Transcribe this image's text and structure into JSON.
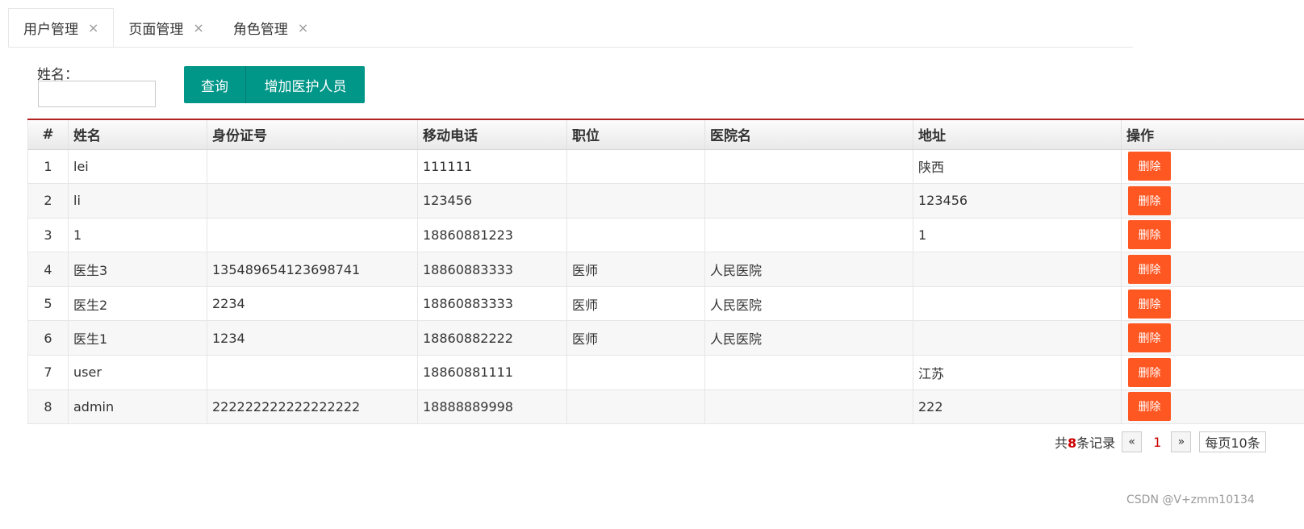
{
  "tabs": [
    {
      "label": "用户管理",
      "close": "×"
    },
    {
      "label": "页面管理",
      "close": "×"
    },
    {
      "label": "角色管理",
      "close": "×"
    }
  ],
  "search": {
    "label": "姓名：",
    "value": "",
    "placeholder": ""
  },
  "buttons": {
    "query": "查询",
    "add": "增加医护人员"
  },
  "table": {
    "headers": [
      "#",
      "姓名",
      "身份证号",
      "移动电话",
      "职位",
      "医院名",
      "地址",
      "操作"
    ],
    "delete_label": "删除",
    "rows": [
      [
        "1",
        "lei",
        "",
        "111111",
        "",
        "",
        "陕西"
      ],
      [
        "2",
        "li",
        "",
        "123456",
        "",
        "",
        "123456"
      ],
      [
        "3",
        "1",
        "",
        "18860881223",
        "",
        "",
        "1"
      ],
      [
        "4",
        "医生3",
        "135489654123698741",
        "18860883333",
        "医师",
        "人民医院",
        ""
      ],
      [
        "5",
        "医生2",
        "2234",
        "18860883333",
        "医师",
        "人民医院",
        ""
      ],
      [
        "6",
        "医生1",
        "1234",
        "18860882222",
        "医师",
        "人民医院",
        ""
      ],
      [
        "7",
        "user",
        "",
        "18860881111",
        "",
        "",
        "江苏"
      ],
      [
        "8",
        "admin",
        "222222222222222222",
        "18888889998",
        "",
        "",
        "222"
      ]
    ]
  },
  "pager": {
    "prefix": "共",
    "count": "8",
    "suffix": "条记录",
    "prev": "«",
    "current": "1",
    "next": "»",
    "page_size": "每页10条"
  },
  "watermark": "CSDN @V+zmm10134",
  "colors": {
    "primary": "#009688",
    "danger": "#ff5722",
    "header_accent": "#b22222"
  }
}
